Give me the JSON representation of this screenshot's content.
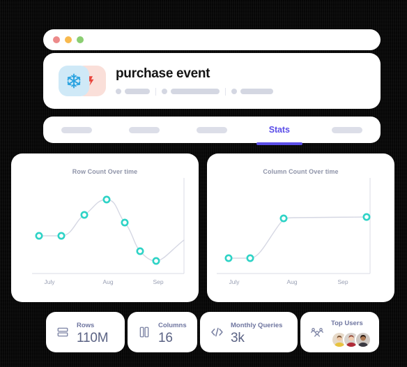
{
  "window": {
    "traffic_lights": [
      {
        "name": "close",
        "color": "#ec8a8a"
      },
      {
        "name": "minimize",
        "color": "#f8b94e"
      },
      {
        "name": "maximize",
        "color": "#8bce72"
      }
    ]
  },
  "header": {
    "title": "purchase event",
    "icons": [
      {
        "name": "snowflake-icon",
        "color": "#2aa3e0",
        "tile": "#cfe9f7"
      },
      {
        "name": "fivetran-icon",
        "color": "#e8453c",
        "tile": "#fadfd9"
      }
    ],
    "meta_groups": [
      {
        "pill_width": 36
      },
      {
        "pill_width": 70
      },
      {
        "pill_width": 47
      }
    ]
  },
  "tabs": [
    {
      "label": "",
      "active": false,
      "skeleton": true
    },
    {
      "label": "",
      "active": false,
      "skeleton": true
    },
    {
      "label": "",
      "active": false,
      "skeleton": true
    },
    {
      "label": "Stats",
      "active": true,
      "skeleton": false
    },
    {
      "label": "",
      "active": false,
      "skeleton": true
    }
  ],
  "accent": {
    "tab_active": "#5b4ee8",
    "marker": "#2ed3c6",
    "line": "#d5d7e3",
    "axis": "#d9dbe6",
    "skeleton": "#d4d7e2"
  },
  "chart_data": [
    {
      "type": "line",
      "title": "Row Count Over time",
      "xlabel": "",
      "ylabel": "",
      "grid": false,
      "legend": false,
      "axis_ticks": [
        "July",
        "Aug",
        "Sep"
      ],
      "tick_positions": [
        0.14,
        0.47,
        0.79
      ],
      "x": [
        0,
        1,
        2,
        3,
        4,
        5,
        6,
        7
      ],
      "values": [
        42,
        42,
        62,
        88,
        56,
        30,
        12,
        40
      ],
      "ylim": [
        0,
        100
      ],
      "markers_visible": 7
    },
    {
      "type": "line",
      "title": "Column Count Over time",
      "xlabel": "",
      "ylabel": "",
      "grid": false,
      "legend": false,
      "axis_ticks": [
        "July",
        "Aug",
        "Sep"
      ],
      "tick_positions": [
        0.14,
        0.47,
        0.79
      ],
      "x": [
        0,
        1,
        2,
        3
      ],
      "values": [
        18,
        18,
        72,
        74
      ],
      "ylim": [
        0,
        100
      ],
      "markers_visible": 4
    }
  ],
  "stats": [
    {
      "icon": "rows-icon",
      "label": "Rows",
      "value": "110M"
    },
    {
      "icon": "columns-icon",
      "label": "Columns",
      "value": "16"
    },
    {
      "icon": "code-icon",
      "label": "Monthly Queries",
      "value": "3k"
    },
    {
      "icon": "users-group-icon",
      "label": "Top Users",
      "value": "",
      "avatars": 3
    }
  ]
}
